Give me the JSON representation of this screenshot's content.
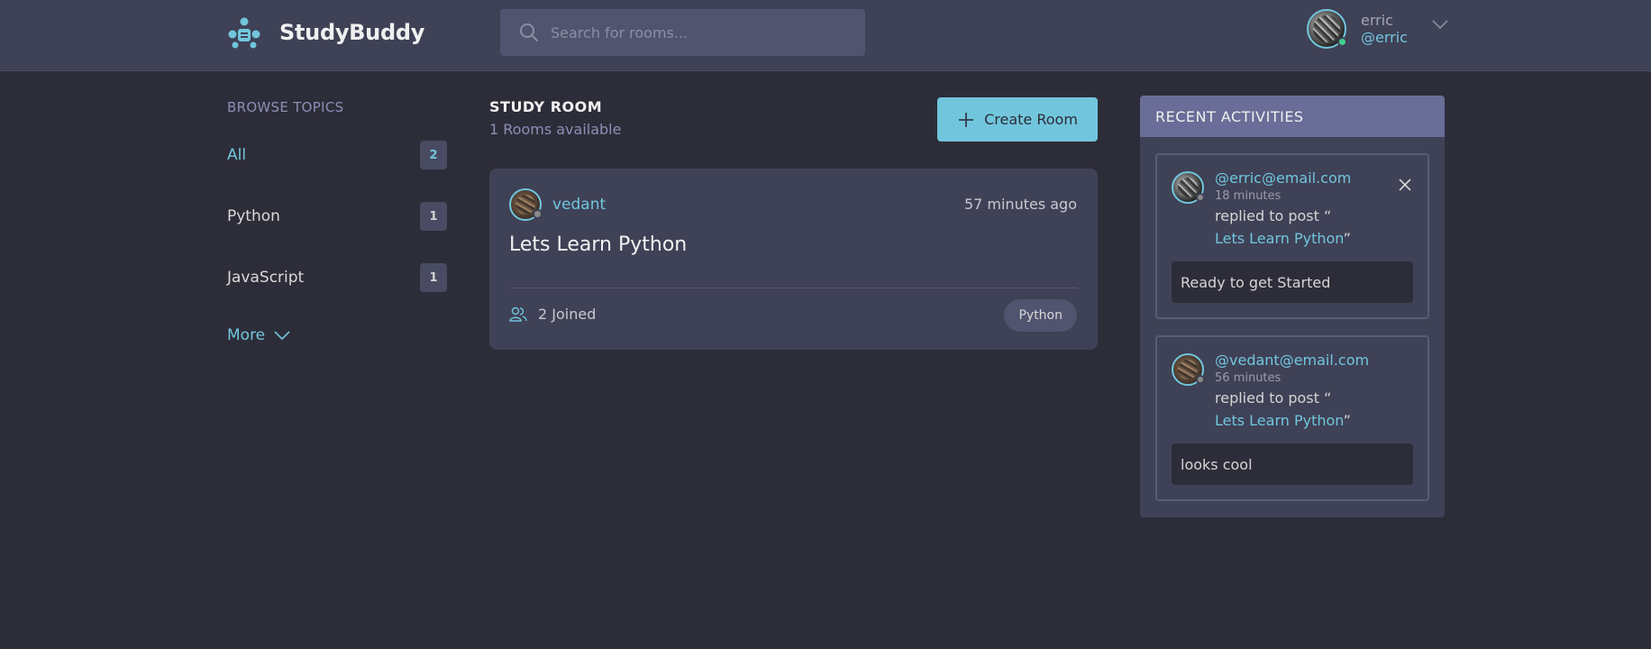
{
  "header": {
    "brand": "StudyBuddy",
    "search_placeholder": "Search for rooms...",
    "user": {
      "name": "erric",
      "handle": "@erric",
      "status": "online"
    }
  },
  "sidebar": {
    "title": "BROWSE TOPICS",
    "topics": [
      {
        "label": "All",
        "count": "2",
        "active": true
      },
      {
        "label": "Python",
        "count": "1"
      },
      {
        "label": "JavaScript",
        "count": "1"
      }
    ],
    "more_label": "More"
  },
  "main": {
    "title": "STUDY ROOM",
    "subtitle": "1 Rooms available",
    "create_label": "Create Room",
    "rooms": [
      {
        "host": "vedant",
        "time": "57 minutes ago",
        "name": "Lets Learn Python",
        "joined": "2 Joined",
        "topic": "Python"
      }
    ]
  },
  "activities": {
    "title": "RECENT ACTIVITIES",
    "items": [
      {
        "user": "@erric@email.com",
        "time": "18 minutes",
        "action": "replied to post “",
        "post": "Lets Learn Python",
        "post_close": "”",
        "body": "Ready to get Started"
      },
      {
        "user": "@vedant@email.com",
        "time": "56 minutes",
        "action": "replied to post “",
        "post": "Lets Learn Python",
        "post_close": "”",
        "body": "looks cool"
      }
    ]
  },
  "colors": {
    "background": "#2d2d39",
    "surface": "#3f4156",
    "accent": "#71c6dd",
    "activity_header": "#696d97"
  }
}
